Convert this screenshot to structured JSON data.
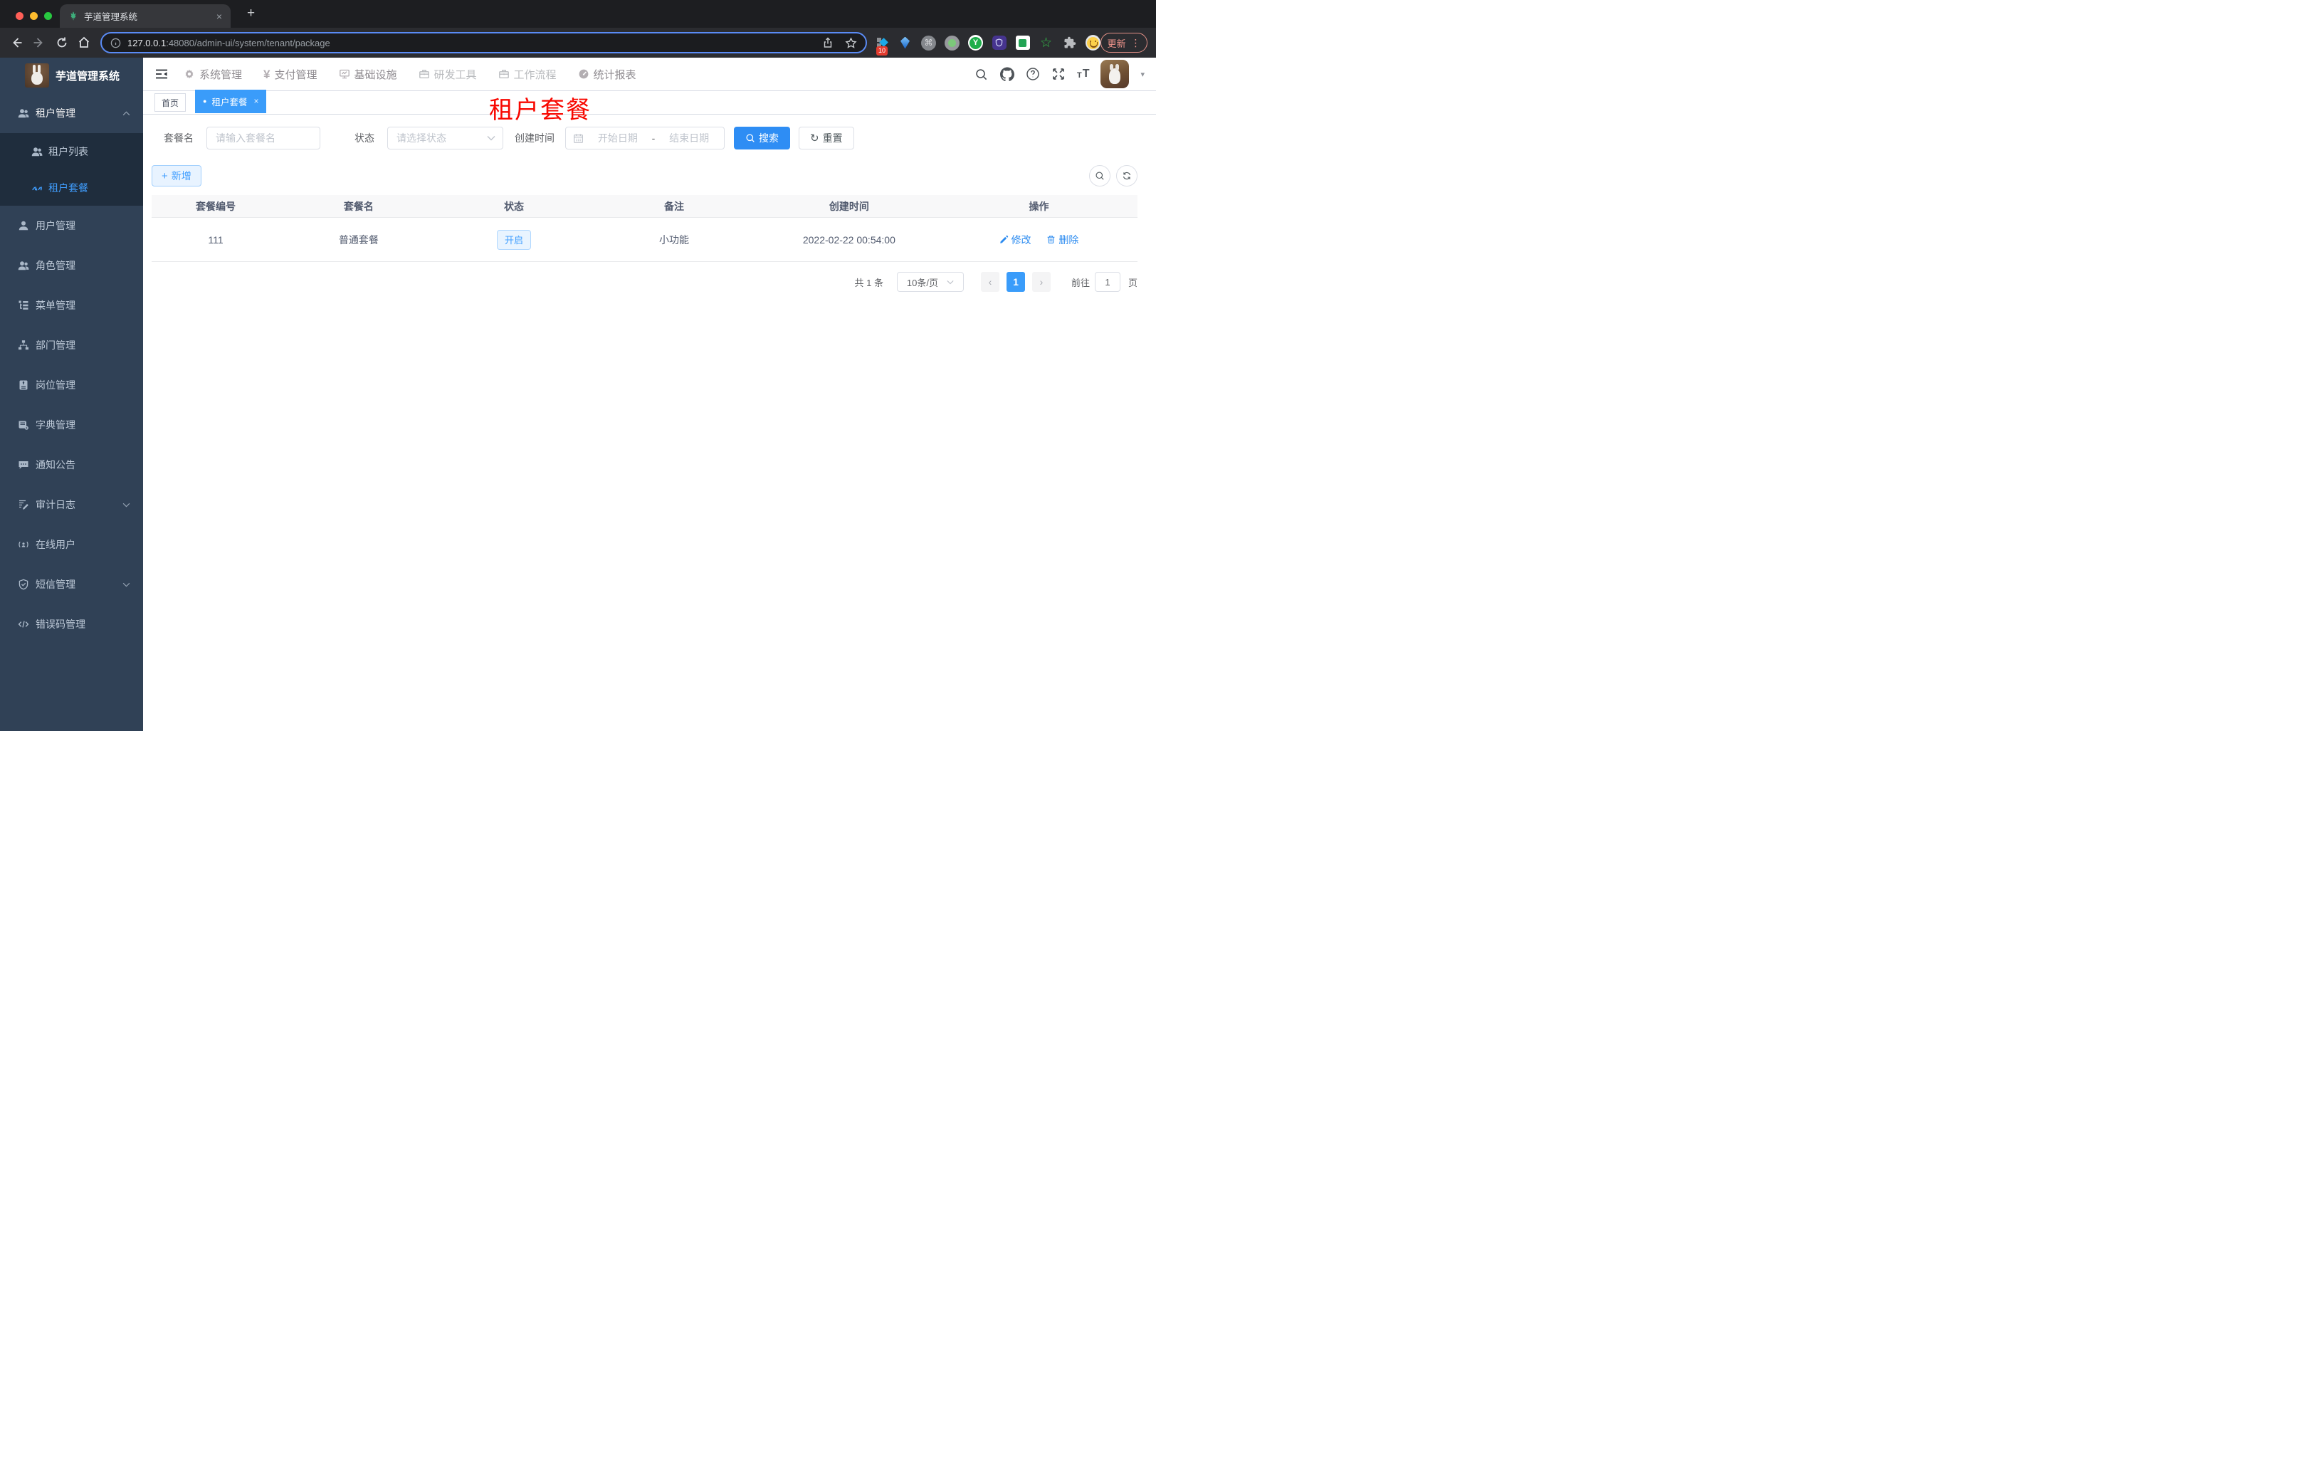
{
  "browser": {
    "tab_title": "芋道管理系统",
    "url_host": "127.0.0.1",
    "url_path": ":48080/admin-ui/system/tenant/package",
    "update_label": "更新",
    "ext_badge": "10"
  },
  "icons": {
    "yen": "¥",
    "cmd": "⌘",
    "dots_v": "⋮",
    "plus_tab": "+",
    "close_tab": "×",
    "chev_left": "‹",
    "chev_right": "›",
    "dot": "●",
    "close_tag": "×",
    "refresh": "↻",
    "question": "?",
    "t_small": "T",
    "t_big": "T",
    "star": "☆",
    "ext_y": "Y",
    "caret_down": "▾",
    "dash": "-"
  },
  "sidebar": {
    "app_title": "芋道管理系统",
    "items": [
      {
        "label": "租户管理"
      },
      {
        "label": "租户列表"
      },
      {
        "label": "租户套餐"
      },
      {
        "label": "用户管理"
      },
      {
        "label": "角色管理"
      },
      {
        "label": "菜单管理"
      },
      {
        "label": "部门管理"
      },
      {
        "label": "岗位管理"
      },
      {
        "label": "字典管理"
      },
      {
        "label": "通知公告"
      },
      {
        "label": "审计日志"
      },
      {
        "label": "在线用户"
      },
      {
        "label": "短信管理"
      },
      {
        "label": "错误码管理"
      }
    ]
  },
  "topnav": {
    "items": [
      {
        "label": "系统管理"
      },
      {
        "label": "支付管理"
      },
      {
        "label": "基础设施"
      },
      {
        "label": "研发工具"
      },
      {
        "label": "工作流程"
      },
      {
        "label": "统计报表"
      }
    ]
  },
  "tags": {
    "home": "首页",
    "active": "租户套餐"
  },
  "page_watermark": "租户套餐",
  "filters": {
    "name_label": "套餐名",
    "name_placeholder": "请输入套餐名",
    "status_label": "状态",
    "status_placeholder": "请选择状态",
    "created_label": "创建时间",
    "date_start": "开始日期",
    "date_sep": "-",
    "date_end": "结束日期",
    "search_label": "搜索",
    "reset_label": "重置"
  },
  "toolbar": {
    "add_label": "新增"
  },
  "table": {
    "columns": [
      "套餐编号",
      "套餐名",
      "状态",
      "备注",
      "创建时间",
      "操作"
    ],
    "rows": [
      {
        "package_id": "111",
        "name": "普通套餐",
        "status": "开启",
        "remark": "小功能",
        "created_at": "2022-02-22 00:54:00",
        "edit_label": "修改",
        "delete_label": "删除"
      }
    ]
  },
  "pagination": {
    "total": "共 1 条",
    "page_size": "10条/页",
    "current_page": "1",
    "goto_label": "前往",
    "goto_value": "1",
    "unit_label": "页"
  },
  "colors": {
    "primary": "#409eff",
    "button_blue": "#2e8df4",
    "tag_active_bg": "#3a9cfa",
    "sidebar_bg": "#304156",
    "submenu_bg": "#1f2d3d",
    "watermark_red": "#f80700"
  }
}
